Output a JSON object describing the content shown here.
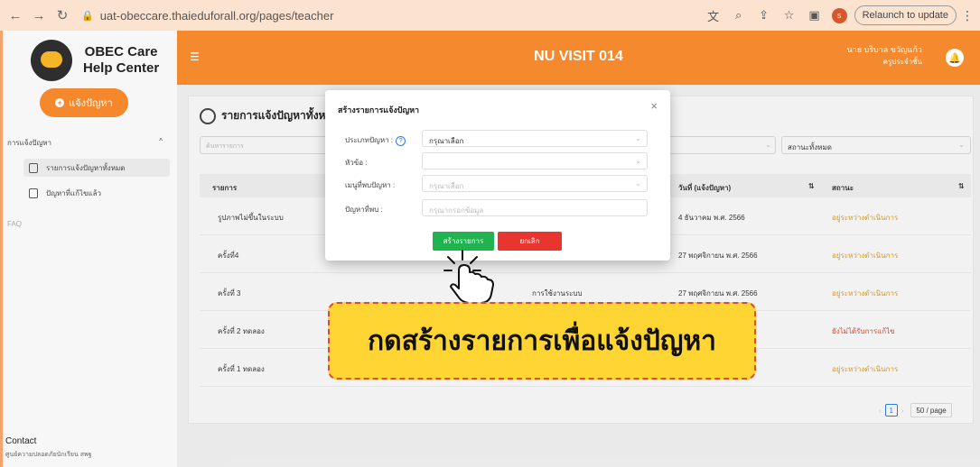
{
  "browser": {
    "url": "uat-obeccare.thaieduforall.org/pages/teacher",
    "relaunch_label": "Relaunch to update",
    "profile_initial": "s"
  },
  "sidebar": {
    "logo_line1": "OBEC Care",
    "logo_line2": "Help Center",
    "report_button": "แจ้งปัญหา",
    "group_label": "การแจ้งปัญหา",
    "items": [
      {
        "label": "รายการแจ้งปัญหาทั้งหมด"
      },
      {
        "label": "ปัญหาที่แก้ไขแล้ว"
      }
    ],
    "faq": "FAQ",
    "contact_title": "Contact",
    "contact_sub": "ศูนย์ความปลอดภัยนักเรียน สพฐ"
  },
  "header": {
    "title": "NU VISIT 014",
    "user_name": "นาย บริบาล ขวัญแก้ว",
    "user_role": "ครูประจำชั้น"
  },
  "main": {
    "card_title": "รายการแจ้งปัญหาทั้งหม",
    "search_placeholder": "ค้นหารายการ",
    "status_filter": "สถานะทั้งหมด",
    "columns": {
      "item": "รายการ",
      "date": "วันที่ (แจ้งปัญหา)",
      "status": "สถานะ"
    },
    "rows": [
      {
        "item": "รูปภาพไม่ขึ้นในระบบ",
        "category": "",
        "date": "4 ธันวาคม พ.ศ. 2566",
        "status": "อยู่ระหว่างดำเนินการ",
        "status_color": "#e0a020"
      },
      {
        "item": "ครั้งที่4",
        "category": "",
        "date": "27 พฤศจิกายน พ.ศ. 2566",
        "status": "อยู่ระหว่างดำเนินการ",
        "status_color": "#e0a020"
      },
      {
        "item": "ครั้งที่ 3",
        "category": "การใช้งานระบบ",
        "date": "27 พฤศจิกายน พ.ศ. 2566",
        "status": "อยู่ระหว่างดำเนินการ",
        "status_color": "#e0a020"
      },
      {
        "item": "ครั้งที่ 2 ทดลอง",
        "category": "",
        "date": "",
        "status": "ยังไม่ได้รับการแก้ไข",
        "status_color": "#d9462c"
      },
      {
        "item": "ครั้งที่ 1 ทดลอง",
        "category": "",
        "date": "",
        "status": "อยู่ระหว่างดำเนินการ",
        "status_color": "#e0a020"
      }
    ],
    "pager": {
      "current": "1",
      "page_size": "50 / page"
    }
  },
  "modal": {
    "title": "สร้างรายการแจ้งปัญหา",
    "fields": {
      "type_label": "ประเภทปัญหา :",
      "type_value": "กรุณาเลือก",
      "topic_label": "หัวข้อ :",
      "topic_value": "",
      "location_label": "เมนูที่พบปัญหา :",
      "location_value": "กรุณาเลือก",
      "problem_label": "ปัญหาที่พบ :",
      "problem_placeholder": "กรุณากรอกข้อมูล"
    },
    "create_button": "สร้างรายการ",
    "cancel_button": "ยกเลิก"
  },
  "annotation": {
    "text": "กดสร้างรายการเพื่อแจ้งปัญหา"
  }
}
